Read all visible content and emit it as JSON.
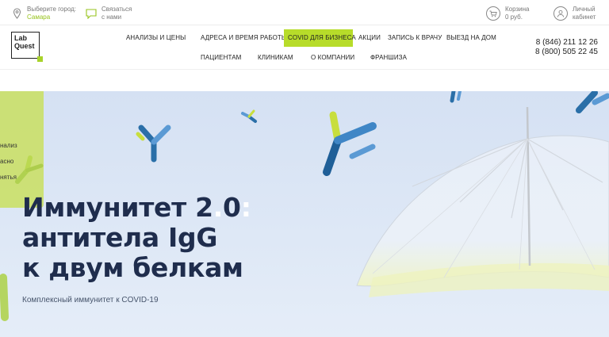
{
  "topbar": {
    "city_label": "Выберите город:",
    "city_value": "Самара",
    "contact_line1": "Связаться",
    "contact_line2": "с нами",
    "cart_label": "Корзина",
    "cart_amount": "0 руб.",
    "account_line1": "Личный",
    "account_line2": "кабинет"
  },
  "header": {
    "logo_line1": "Lab",
    "logo_line2": "Quest",
    "nav_row1": [
      "АНАЛИЗЫ И ЦЕНЫ",
      "АДРЕСА И ВРЕМЯ РАБОТЫ",
      "COVID ДЛЯ БИЗНЕСА",
      "АКЦИИ",
      "ЗАПИСЬ К ВРАЧУ",
      "ВЫЕЗД НА ДОМ"
    ],
    "nav_row2": [
      "ПАЦИЕНТАМ",
      "КЛИНИКАМ",
      "О КОМПАНИИ",
      "ФРАНШИЗА"
    ],
    "phone1": "8 (846) 211 12 26",
    "phone2": "8 (800) 505 22 45"
  },
  "sidebar_tab": {
    "lines": [
      "нализ",
      "асно",
      "нятья"
    ]
  },
  "hero": {
    "title_line1": "Иммунитет 2",
    "title_dot": ".",
    "title_line1_end": "0",
    "title_colon": ":",
    "title_line2": "антитела IgG",
    "title_line3": "к двум белкам",
    "subtitle": "Комплексный иммунитет к COVID-19"
  },
  "colors": {
    "accent": "#b7dc2a",
    "accent_text": "#97c31c",
    "hero_bg": "#dde7f5",
    "title": "#1f2d4d"
  }
}
